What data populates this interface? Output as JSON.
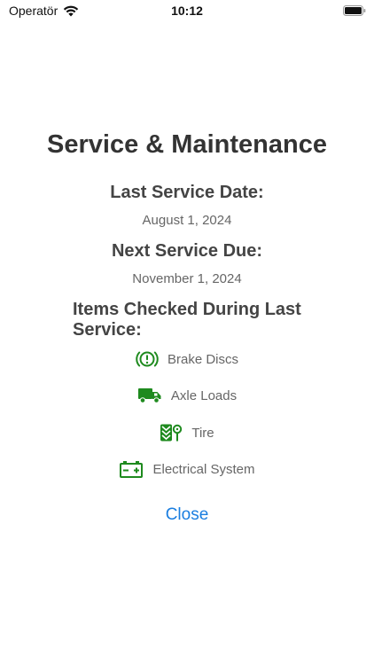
{
  "status_bar": {
    "carrier": "Operatör",
    "time": "10:12"
  },
  "page": {
    "title": "Service & Maintenance",
    "last_service_label": "Last Service Date:",
    "last_service_value": "August 1, 2024",
    "next_service_label": "Next Service Due:",
    "next_service_value": "November 1, 2024",
    "items_heading": "Items Checked During Last Service:",
    "items": [
      {
        "label": "Brake Discs",
        "icon": "brake-warning-icon"
      },
      {
        "label": "Axle Loads",
        "icon": "truck-icon"
      },
      {
        "label": "Tire",
        "icon": "tire-pressure-icon"
      },
      {
        "label": "Electrical System",
        "icon": "car-battery-icon"
      }
    ],
    "close_label": "Close"
  },
  "colors": {
    "icon_green": "#1e8a1e",
    "link_blue": "#1a7ee0"
  }
}
